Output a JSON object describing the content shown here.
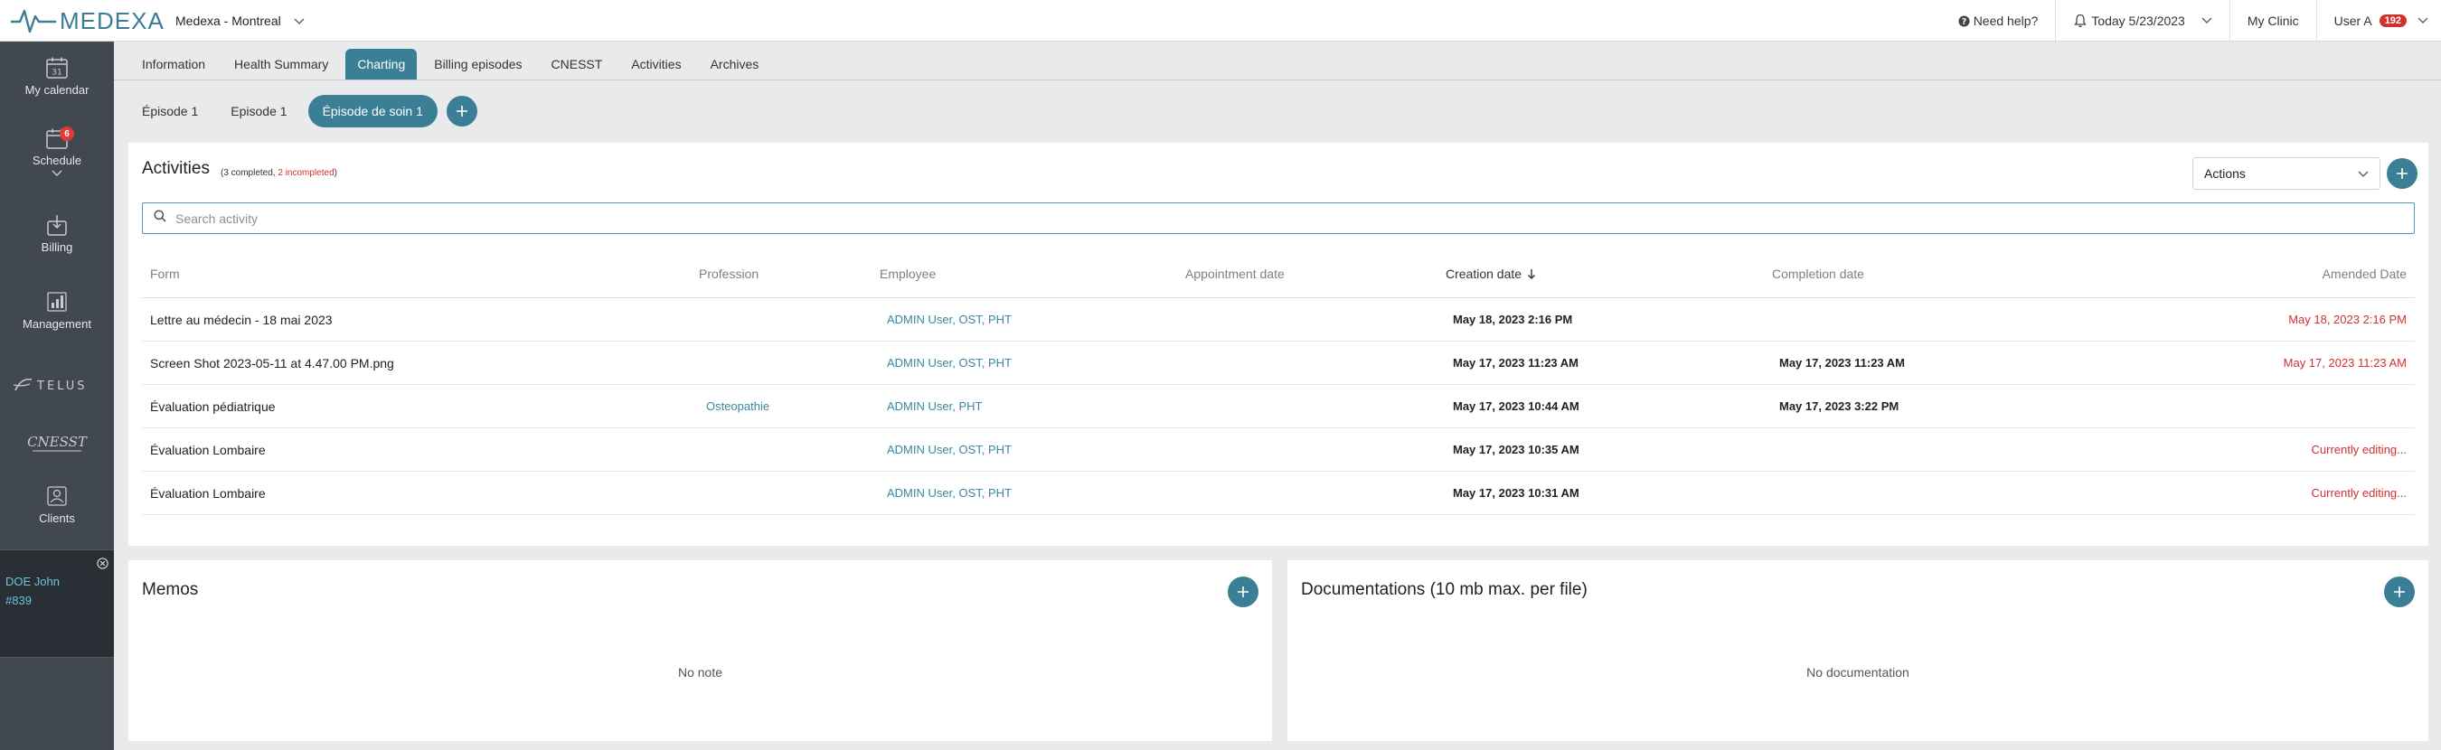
{
  "brand": {
    "name": "MEDEXA",
    "accent": "#3b7f97"
  },
  "header": {
    "clinic": "Medexa - Montreal",
    "help": "Need help?",
    "date": "Today 5/23/2023",
    "my_clinic": "My Clinic",
    "user": "User A",
    "user_badge": "192"
  },
  "sidebar": {
    "items": [
      {
        "label": "My calendar",
        "icon": "calendar-icon",
        "icon_text": "31"
      },
      {
        "label": "Schedule",
        "icon": "schedule-icon",
        "badge": "6"
      },
      {
        "label": "Billing",
        "icon": "billing-icon"
      },
      {
        "label": "Management",
        "icon": "chart-icon"
      }
    ],
    "partners": [
      "TELUS",
      "CNESST"
    ],
    "clients_label": "Clients",
    "patient": {
      "name": "DOE John",
      "number": "#839"
    }
  },
  "tabs": [
    "Information",
    "Health Summary",
    "Charting",
    "Billing episodes",
    "CNESST",
    "Activities",
    "Archives"
  ],
  "episodes": [
    "Épisode 1",
    "Episode 1",
    "Épisode de soin 1"
  ],
  "activities": {
    "title": "Activities",
    "completed_text": "(3 completed, ",
    "incompleted_text": "2 incompleted",
    "close_paren": ")",
    "actions_label": "Actions",
    "search_placeholder": "Search activity",
    "columns": [
      "Form",
      "Profession",
      "Employee",
      "Appointment date",
      "Creation date",
      "Completion date",
      "Amended Date"
    ],
    "rows": [
      {
        "form": "Lettre au médecin - 18 mai 2023",
        "profession": "",
        "employee": "ADMIN User, OST, PHT",
        "appointment": "",
        "created": "May 18, 2023 2:16 PM",
        "completed": "",
        "amended": "May 18, 2023 2:16 PM"
      },
      {
        "form": "Screen Shot 2023-05-11 at 4.47.00 PM.png",
        "profession": "",
        "employee": "ADMIN User, OST, PHT",
        "appointment": "",
        "created": "May 17, 2023 11:23 AM",
        "completed": "May 17, 2023 11:23 AM",
        "amended": "May 17, 2023 11:23 AM"
      },
      {
        "form": "Évaluation pédiatrique",
        "profession": "Osteopathie",
        "employee": "ADMIN User, PHT",
        "appointment": "",
        "created": "May 17, 2023 10:44 AM",
        "completed": "May 17, 2023 3:22 PM",
        "amended": ""
      },
      {
        "form": "Évaluation Lombaire",
        "profession": "",
        "employee": "ADMIN User, OST, PHT",
        "appointment": "",
        "created": "May 17, 2023 10:35 AM",
        "completed": "",
        "amended": "Currently editing..."
      },
      {
        "form": "Évaluation Lombaire",
        "profession": "",
        "employee": "ADMIN User, OST, PHT",
        "appointment": "",
        "created": "May 17, 2023 10:31 AM",
        "completed": "",
        "amended": "Currently editing..."
      }
    ]
  },
  "memos": {
    "title": "Memos",
    "empty": "No note"
  },
  "documentations": {
    "title": "Documentations (10 mb max. per file)",
    "empty": "No documentation"
  }
}
